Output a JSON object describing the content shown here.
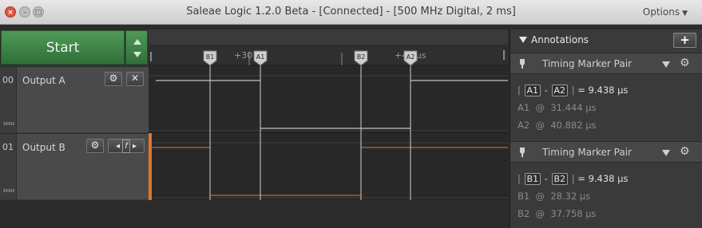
{
  "window": {
    "title": "Saleae Logic 1.2.0 Beta - [Connected] - [500 MHz Digital, 2 ms]",
    "options_label": "Options",
    "controls": [
      "close",
      "minimize",
      "maximize"
    ]
  },
  "toolbar": {
    "start_label": "Start"
  },
  "channels": [
    {
      "number": "00",
      "name": "Output A"
    },
    {
      "number": "01",
      "name": "Output B"
    }
  ],
  "timeline": {
    "markers": [
      "B1",
      "A1",
      "B2",
      "A2"
    ],
    "tick_labels": [
      "+30",
      "+40 μs"
    ]
  },
  "annotations": {
    "header": "Annotations",
    "add_label": "+",
    "pairs": [
      {
        "title": "Timing Marker Pair",
        "m1": "A1",
        "m2": "A2",
        "diff": "= 9.438 μs",
        "row1_label": "A1",
        "row1_value": "31.444 μs",
        "row2_label": "A2",
        "row2_value": "40.882 μs"
      },
      {
        "title": "Timing Marker Pair",
        "m1": "B1",
        "m2": "B2",
        "diff": "= 9.438 μs",
        "row1_label": "B1",
        "row1_value": "28.32 μs",
        "row2_label": "B2",
        "row2_value": "37.758 μs"
      }
    ]
  },
  "colors": {
    "accent_green": "#3f8a48",
    "channel_b": "#e0772b",
    "signal_white": "#e8e8e8"
  }
}
